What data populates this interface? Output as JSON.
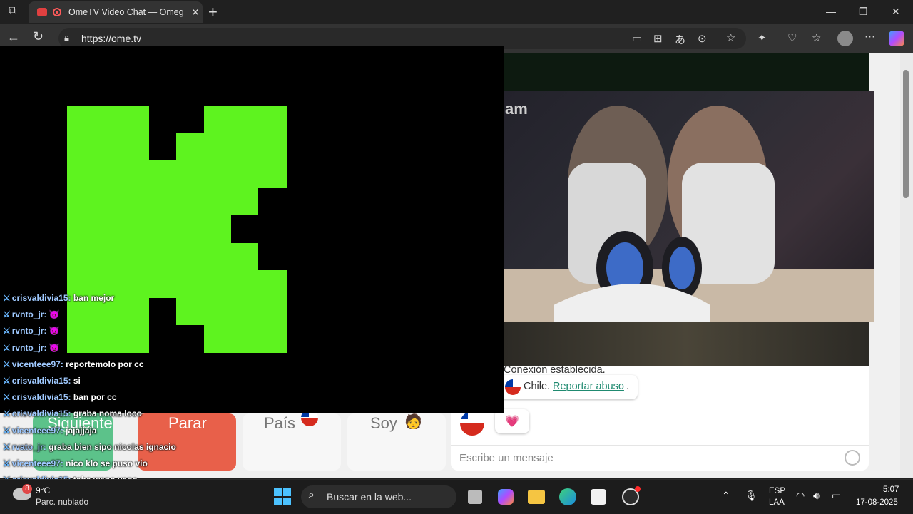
{
  "browser": {
    "tab_title": "OmeTV Video Chat — Omeg",
    "url": "https://ome.tv"
  },
  "remote_video": {
    "overlay_text": "am"
  },
  "chat": {
    "connection_message": "Conexión establecida.",
    "country": "Chile.",
    "report_link": "Reportar abuso",
    "report_suffix": ".",
    "reaction": "💗",
    "input_placeholder": "Escribe un mensaje"
  },
  "buttons": {
    "next": "Siguiente",
    "stop": "Parar",
    "country": "País",
    "gender": "Soy",
    "gender_emoji": "🧑"
  },
  "stream_chat": [
    {
      "user": "crisvaldivia15:",
      "msg": "ban mejor"
    },
    {
      "user": "rvnto_jr:",
      "msg": "😈"
    },
    {
      "user": "rvnto_jr:",
      "msg": "😈"
    },
    {
      "user": "rvnto_jr:",
      "msg": "😈"
    },
    {
      "user": "vicenteee97:",
      "msg": "reportemolo por cc"
    },
    {
      "user": "crisvaldivia15:",
      "msg": "si"
    },
    {
      "user": "crisvaldivia15:",
      "msg": "ban por cc"
    },
    {
      "user": "crisvaldivia15:",
      "msg": "graba noma loco"
    },
    {
      "user": "vicenteee97:",
      "msg": "jajajjaja"
    },
    {
      "user": "rvato_jr:",
      "msg": "graba bien sipo nicolas ignacio"
    },
    {
      "user": "vicenteee97:",
      "msg": "nico klo se puso vio"
    },
    {
      "user": "crisvaldivia15:",
      "msg": "taba weno yapo"
    }
  ],
  "taskbar": {
    "weather_temp": "9°C",
    "weather_desc": "Parc. nublado",
    "weather_badge": "8",
    "search_label": "Buscar en la web...",
    "lang_top": "ESP",
    "lang_bottom": "LAA",
    "time": "5:07",
    "date": "17-08-2025"
  },
  "colors": {
    "logo_green": "#5ef31f",
    "stop_red": "#e8604a",
    "next_green": "#5cc28a",
    "link_teal": "#1f8a70"
  }
}
